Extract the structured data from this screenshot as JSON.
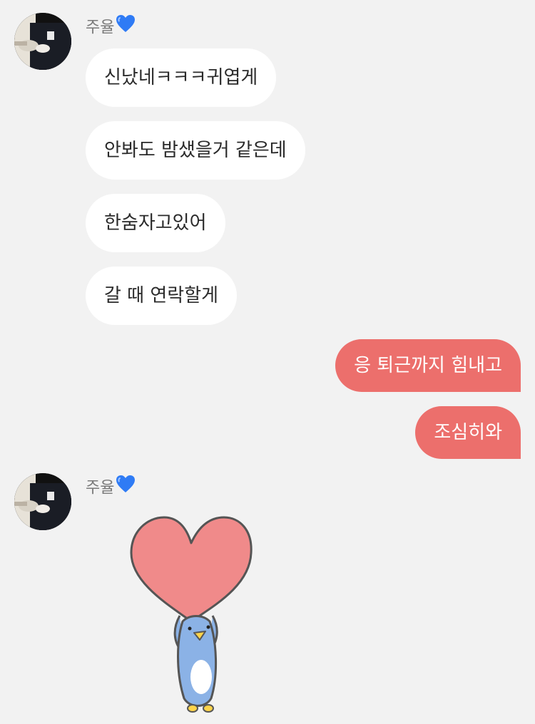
{
  "chat": {
    "messages_group_1": {
      "sender_name": "주율",
      "bubbles": [
        "신났네ㅋㅋㅋ귀엽게",
        "안봐도 밤샜을거 같은데",
        "한숨자고있어",
        "갈 때 연락할게"
      ]
    },
    "my_messages": [
      "응 퇴근까지 힘내고",
      "조심히와"
    ],
    "messages_group_2": {
      "sender_name": "주율"
    }
  },
  "icons": {
    "name_heart": "blue-heart-icon",
    "sticker": "penguin-holding-heart-sticker"
  },
  "colors": {
    "background": "#f2f2f2",
    "incoming_bubble": "#ffffff",
    "outgoing_bubble": "#ec6f6c",
    "name_text": "#7a7a7a",
    "heart_blue": "#2f7bf5",
    "sticker_heart": "#f08a8a",
    "penguin_blue": "#8bb2e6"
  }
}
